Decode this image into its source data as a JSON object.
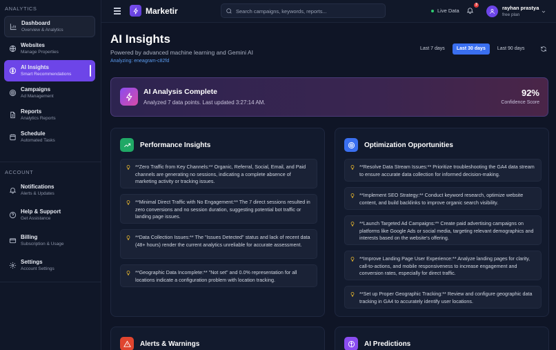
{
  "sidebar": {
    "section_analytics": "ANALYTICS",
    "section_account": "ACCOUNT",
    "items": [
      {
        "title": "Dashboard",
        "sub": "Overview & Analytics",
        "icon": "bar-chart-icon"
      },
      {
        "title": "Websites",
        "sub": "Manage Properties",
        "icon": "globe-icon"
      },
      {
        "title": "AI Insights",
        "sub": "Smart Recommendations",
        "icon": "brain-icon"
      },
      {
        "title": "Campaigns",
        "sub": "Ad Management",
        "icon": "target-icon"
      },
      {
        "title": "Reports",
        "sub": "Analytics Reports",
        "icon": "document-icon"
      },
      {
        "title": "Schedule",
        "sub": "Automated Tasks",
        "icon": "calendar-icon"
      }
    ],
    "account_items": [
      {
        "title": "Notifications",
        "sub": "Alerts & Updates",
        "icon": "bell-icon"
      },
      {
        "title": "Help & Support",
        "sub": "Get Assistance",
        "icon": "help-icon"
      },
      {
        "title": "Billing",
        "sub": "Subscription & Usage",
        "icon": "credit-card-icon"
      },
      {
        "title": "Settings",
        "sub": "Account Settings",
        "icon": "gear-icon"
      }
    ]
  },
  "topbar": {
    "brand": "Marketir",
    "search_placeholder": "Search campaigns, keywords, reports...",
    "live_label": "Live Data",
    "notification_count": "3",
    "user_name": "rayhan prastya",
    "user_plan": "free plan"
  },
  "page": {
    "title": "AI Insights",
    "subtitle": "Powered by advanced machine learning and Gemini AI",
    "analyzing": "Analyzing: eneagram-c82fd",
    "ranges": [
      "Last 7 days",
      "Last 30 days",
      "Last 90 days"
    ],
    "active_range": "Last 30 days"
  },
  "banner": {
    "title": "AI Analysis Complete",
    "subtitle": "Analyzed 7 data points. Last updated 3:27:14 AM.",
    "confidence_value": "92%",
    "confidence_label": "Confidence Score"
  },
  "performance": {
    "title": "Performance Insights",
    "items": [
      "**Zero Traffic from Key Channels:** Organic, Referral, Social, Email, and Paid channels are generating no sessions, indicating a complete absence of marketing activity or tracking issues.",
      "**Minimal Direct Traffic with No Engagement:** The 7 direct sessions resulted in zero conversions and no session duration, suggesting potential bot traffic or landing page issues.",
      "**Data Collection Issues:** The \"Issues Detected\" status and lack of recent data (48+ hours) render the current analytics unreliable for accurate assessment.",
      "**Geographic Data Incomplete:** \"Not set\" and 0.0% representation for all locations indicate a configuration problem with location tracking."
    ]
  },
  "optimization": {
    "title": "Optimization Opportunities",
    "items": [
      "**Resolve Data Stream Issues:** Prioritize troubleshooting the GA4 data stream to ensure accurate data collection for informed decision-making.",
      "**Implement SEO Strategy:** Conduct keyword research, optimize website content, and build backlinks to improve organic search visibility.",
      "**Launch Targeted Ad Campaigns:** Create paid advertising campaigns on platforms like Google Ads or social media, targeting relevant demographics and interests based on the website's offering.",
      "**Improve Landing Page User Experience:** Analyze landing pages for clarity, call-to-actions, and mobile responsiveness to increase engagement and conversion rates, especially for direct traffic.",
      "**Set up Proper Geographic Tracking:** Review and configure geographic data tracking in GA4 to accurately identify user locations."
    ]
  },
  "alerts": {
    "title": "Alerts & Warnings"
  },
  "predictions": {
    "title": "AI Predictions"
  },
  "colors": {
    "accent": "#6d45e8",
    "active_range": "#3a6ff0",
    "performance_icon": "#20a866",
    "optimization_icon": "#3a6ff0",
    "alerts_icon": "#e0452f",
    "predictions_icon": "#8a4cf0",
    "bulb": "#e8b62e",
    "live": "#2ecc71"
  }
}
